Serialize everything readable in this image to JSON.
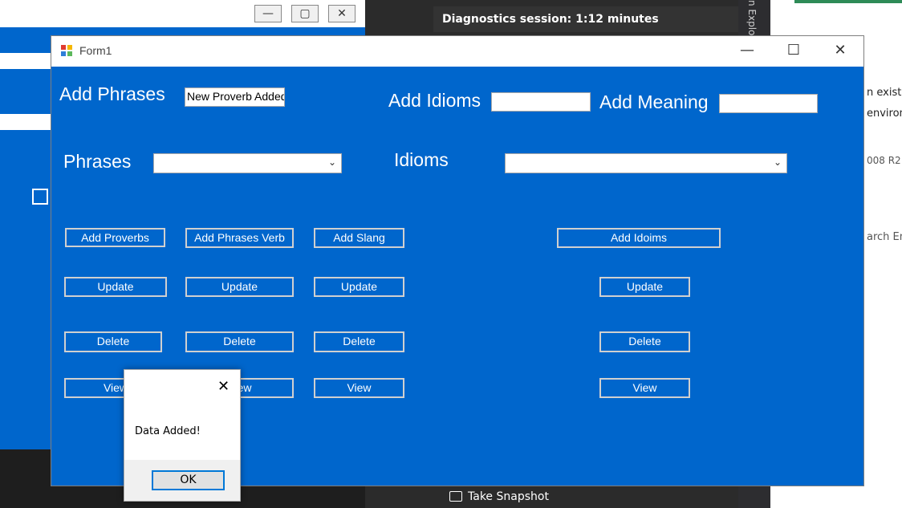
{
  "background": {
    "diagnostics_text": "Diagnostics session: 1:12 minutes",
    "explorer_text": "n Explo",
    "take_snapshot_label": "Take Snapshot",
    "right_panel_texts": [
      "n existir",
      "environ",
      "008 R2",
      "arch Eng"
    ]
  },
  "form": {
    "title": "Form1",
    "add_phrases_label": "Add Phrases",
    "add_phrases_value": "New Proverb Added",
    "add_idioms_label": "Add Idioms",
    "add_idioms_value": "",
    "add_meaning_label": "Add Meaning",
    "add_meaning_value": "",
    "phrases_label": "Phrases",
    "phrases_selected": "",
    "idioms_label": "Idioms",
    "idioms_selected": "",
    "buttons": {
      "add_proverbs": "Add Proverbs",
      "add_phrases_verb": "Add Phrases Verb",
      "add_slang": "Add Slang",
      "add_idioms": "Add Idoims",
      "update": "Update",
      "delete": "Delete",
      "view": "View"
    }
  },
  "dialog": {
    "message": "Data Added!",
    "ok_label": "OK",
    "close_glyph": "✕"
  },
  "colors": {
    "form_background": "#0066cc",
    "button_border": "#d0d0d0",
    "dialog_ok_border": "#0078d7"
  }
}
